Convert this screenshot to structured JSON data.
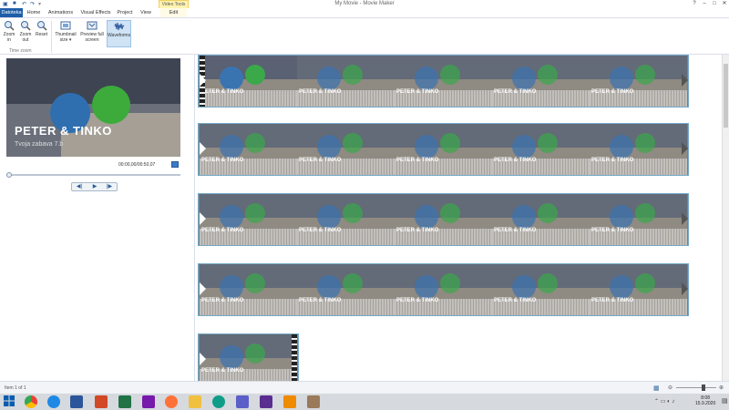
{
  "window": {
    "title": "My Movie - Movie Maker",
    "context_group": "Video Tools"
  },
  "tabs": [
    {
      "label": "Datoteka"
    },
    {
      "label": "Home"
    },
    {
      "label": "Animations"
    },
    {
      "label": "Visual Effects"
    },
    {
      "label": "Project"
    },
    {
      "label": "View"
    },
    {
      "label": "Edit"
    }
  ],
  "ribbon": {
    "group_label": "Time zoom",
    "buttons": [
      {
        "label": "Zoom in",
        "icon": "zoom-in-icon"
      },
      {
        "label": "Zoom out",
        "icon": "zoom-out-icon"
      },
      {
        "label": "Reset",
        "icon": "reset-icon"
      },
      {
        "label": "Thumbnail size ▾",
        "icon": "thumbnail-icon"
      },
      {
        "label": "Preview full screen",
        "icon": "fullscreen-icon"
      },
      {
        "label": "Waveforms",
        "icon": "waveform-icon"
      }
    ]
  },
  "preview": {
    "title": "PETER & TINKO",
    "subtitle": "Tvoja zabava 7.b",
    "timecode": "00:00,00/00:50,07"
  },
  "clip_caption": "PETER & TINKO",
  "status": {
    "item": "Item 1 of 1"
  },
  "taskbar": {
    "time": "8:08",
    "date": "15.9.2020"
  },
  "colors": {
    "file_tab": "#1e5ea8",
    "clip_border": "#74a9c6",
    "accent": "#2b579a"
  }
}
